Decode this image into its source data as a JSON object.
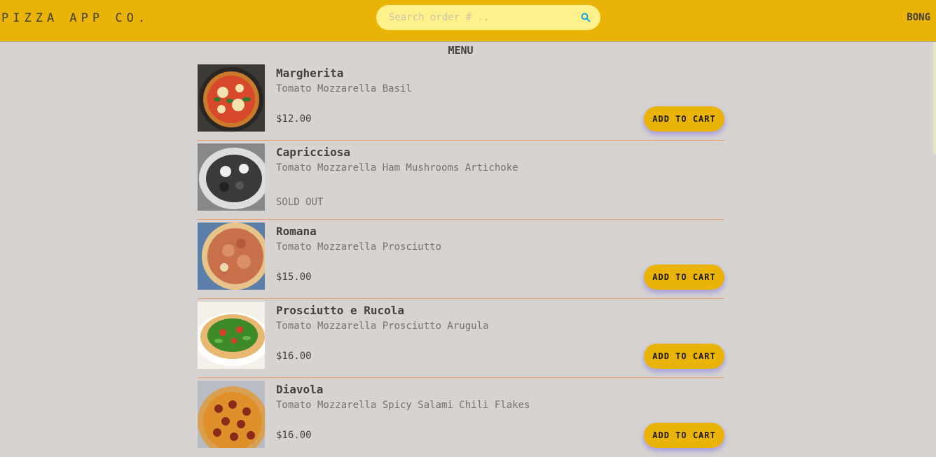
{
  "header": {
    "brand": "PIZZA APP CO.",
    "search_placeholder": "Search order # ..",
    "search_icon": "search-icon",
    "username": "BONG"
  },
  "menu": {
    "title": "MENU",
    "add_label": "ADD TO CART",
    "sold_out_label": "SOLD OUT",
    "items": [
      {
        "name": "Margherita",
        "ingredients": "Tomato Mozzarella Basil",
        "price": "$12.00",
        "sold_out": false
      },
      {
        "name": "Capricciosa",
        "ingredients": "Tomato Mozzarella Ham Mushrooms Artichoke",
        "price": "",
        "sold_out": true
      },
      {
        "name": "Romana",
        "ingredients": "Tomato Mozzarella Prosciutto",
        "price": "$15.00",
        "sold_out": false
      },
      {
        "name": "Prosciutto e Rucola",
        "ingredients": "Tomato Mozzarella Prosciutto Arugula",
        "price": "$16.00",
        "sold_out": false
      },
      {
        "name": "Diavola",
        "ingredients": "Tomato Mozzarella Spicy Salami Chili Flakes",
        "price": "$16.00",
        "sold_out": false
      }
    ]
  },
  "colors": {
    "header_bg": "#eab308",
    "page_bg": "#d6d3d1",
    "search_bg": "#fef08a",
    "divider": "#f0a070",
    "button_bg": "#eab308"
  }
}
